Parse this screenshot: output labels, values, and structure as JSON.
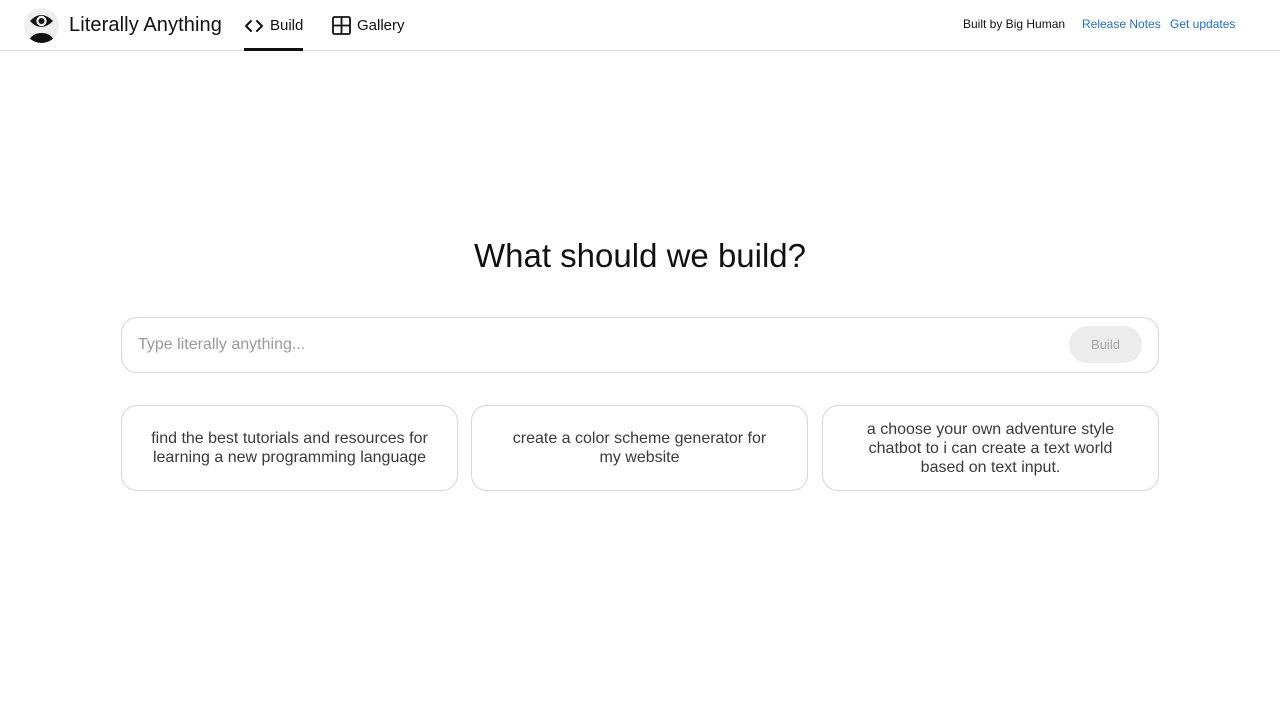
{
  "header": {
    "app_title": "Literally Anything",
    "logo_icon": "eye-person-icon",
    "tabs": [
      {
        "label": "Build",
        "icon": "code-icon",
        "active": true
      },
      {
        "label": "Gallery",
        "icon": "grid-icon",
        "active": false
      }
    ],
    "built_by": "Built by Big Human",
    "release_notes": "Release Notes",
    "get_updates": "Get updates",
    "link_color": "#1a6fd0"
  },
  "main": {
    "headline": "What should we build?",
    "input": {
      "value": "",
      "placeholder": "Type literally anything..."
    },
    "build_button": "Build",
    "suggestions": [
      "find the best tutorials and resources for learning a new programming language",
      "create a color scheme generator for my website",
      "a choose your own adventure style chatbot to i can create a text world based on text input."
    ]
  }
}
